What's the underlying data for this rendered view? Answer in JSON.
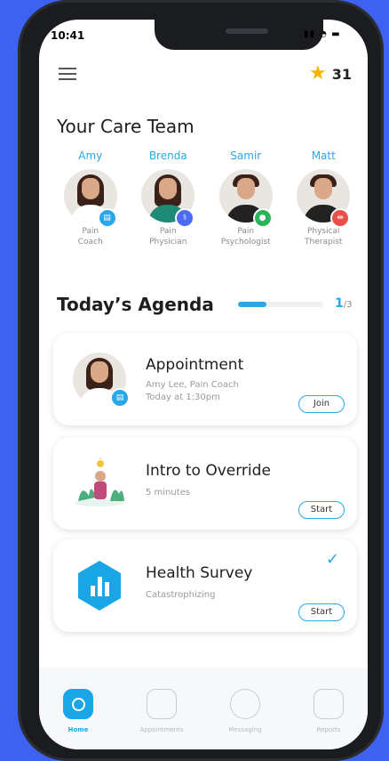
{
  "status": {
    "time": "10:41",
    "icons": "▮▮ ◔ ▬"
  },
  "header": {
    "points": "31"
  },
  "care_team": {
    "title": "Your Care Team",
    "members": [
      {
        "name": "Amy",
        "role_line1": "Pain",
        "role_line2": "Coach",
        "badge_color": "#29a7e8"
      },
      {
        "name": "Brenda",
        "role_line1": "Pain",
        "role_line2": "Physician",
        "badge_color": "#4a6cf0"
      },
      {
        "name": "Samir",
        "role_line1": "Pain",
        "role_line2": "Psychologist",
        "badge_color": "#2cb45a"
      },
      {
        "name": "Matt",
        "role_line1": "Physical",
        "role_line2": "Therapist",
        "badge_color": "#e8504a"
      }
    ]
  },
  "agenda": {
    "title": "Today’s Agenda",
    "progress_fraction": 0.33,
    "count_done": "1",
    "count_total": "/3",
    "items": [
      {
        "title": "Appointment",
        "subtitle1": "Amy Lee, Pain Coach",
        "subtitle2": "Today at 1:30pm",
        "button": "Join"
      },
      {
        "title": "Intro to Override",
        "subtitle1": "5 minutes",
        "button": "Start"
      },
      {
        "title": "Health Survey",
        "subtitle1": "Catastrophizing",
        "button": "Start",
        "completed": true
      }
    ]
  },
  "nav": {
    "items": [
      {
        "label": "Home",
        "icon": "home-icon",
        "active": true
      },
      {
        "label": "Appointments",
        "icon": "calendar-icon"
      },
      {
        "label": "Messaging",
        "icon": "chat-icon"
      },
      {
        "label": "Reports",
        "icon": "reports-icon"
      }
    ]
  },
  "colors": {
    "accent": "#29a7e8",
    "background": "#3d62f0",
    "star": "#f5b400"
  }
}
